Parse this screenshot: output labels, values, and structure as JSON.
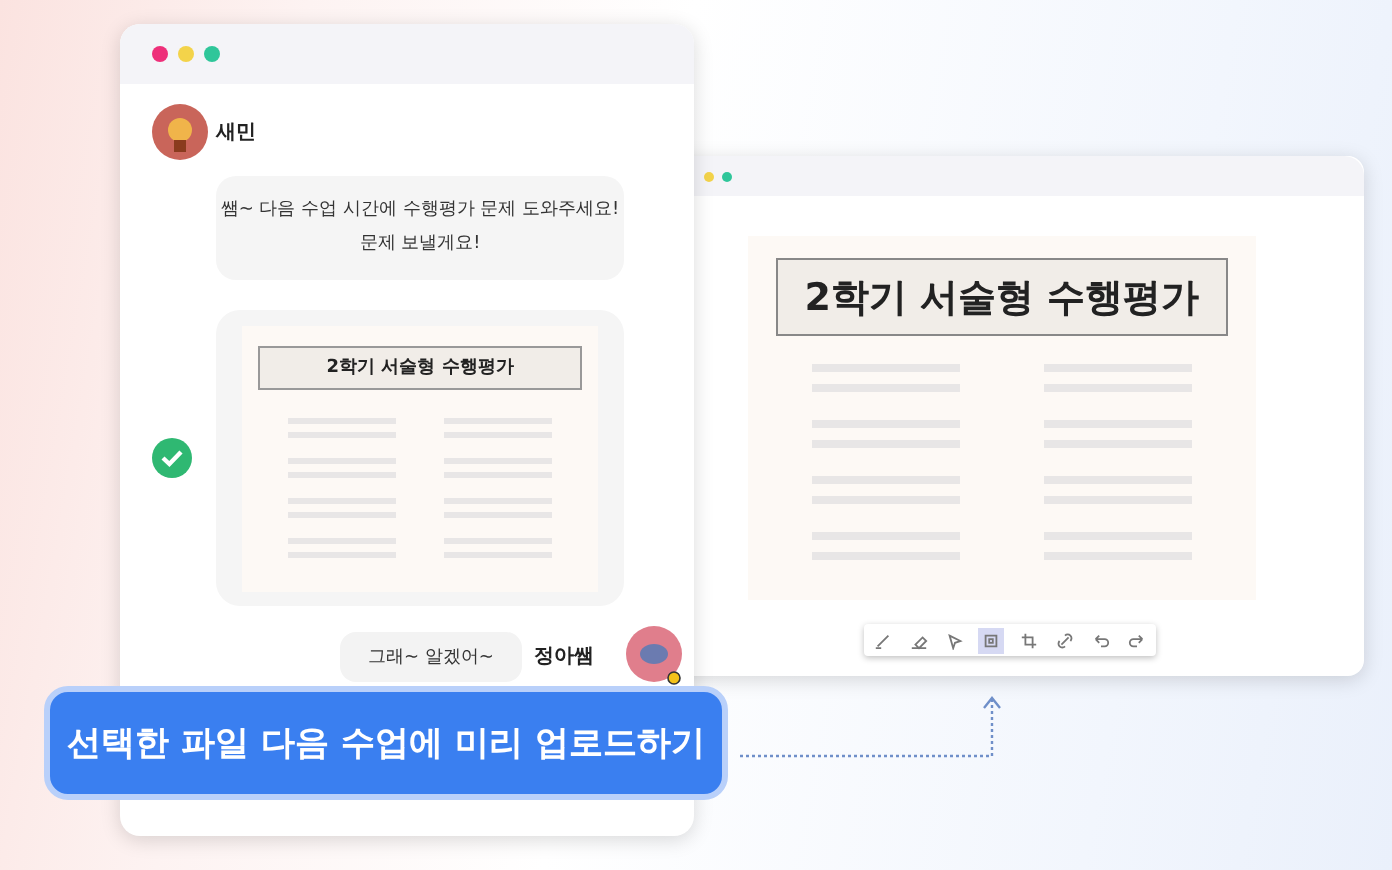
{
  "chat": {
    "sender": "새민",
    "message_lines": [
      "쌤~ 다음 수업 시간에 수행평가 문제 도와주세요!",
      "문제 보낼게요!"
    ],
    "attachment": {
      "title": "2학기 서술형 수행평가",
      "checked": true
    },
    "reply": "그래~ 알겠어~",
    "reply_sender": "정아쌤"
  },
  "document": {
    "title": "2학기 서술형 수행평가",
    "tools": [
      {
        "kind": "pen",
        "selected": false
      },
      {
        "kind": "eraser",
        "selected": false
      },
      {
        "kind": "pointer",
        "selected": false
      },
      {
        "kind": "select",
        "selected": true
      },
      {
        "kind": "crop",
        "selected": false
      },
      {
        "kind": "link",
        "selected": false
      },
      {
        "kind": "undo",
        "selected": false
      },
      {
        "kind": "redo",
        "selected": false
      }
    ]
  },
  "action_button": "선택한 파일 다음 수업에 미리 업로드하기"
}
